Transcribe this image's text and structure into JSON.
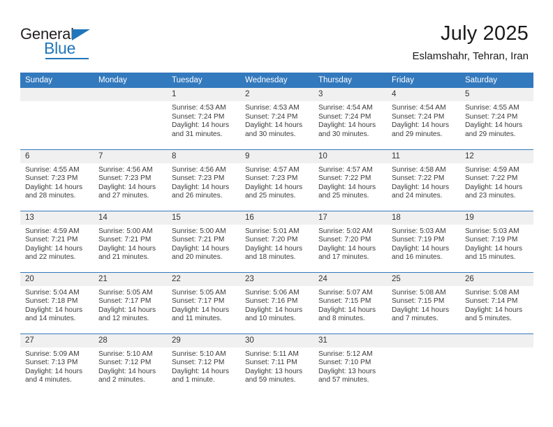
{
  "brand": {
    "name_top": "General",
    "name_bottom": "Blue",
    "accent_color": "#2175ba"
  },
  "header": {
    "title": "July 2025",
    "subtitle": "Eslamshahr, Tehran, Iran"
  },
  "theme": {
    "header_row_bg": "#3379bd",
    "daynum_bg": "#f0f0f0",
    "text_color": "#3a3a3a"
  },
  "weekday_headers": [
    "Sunday",
    "Monday",
    "Tuesday",
    "Wednesday",
    "Thursday",
    "Friday",
    "Saturday"
  ],
  "weeks": [
    [
      {
        "day": "",
        "blank": true
      },
      {
        "day": "",
        "blank": true
      },
      {
        "day": "1",
        "sunrise": "Sunrise: 4:53 AM",
        "sunset": "Sunset: 7:24 PM",
        "daylight1": "Daylight: 14 hours",
        "daylight2": "and 31 minutes."
      },
      {
        "day": "2",
        "sunrise": "Sunrise: 4:53 AM",
        "sunset": "Sunset: 7:24 PM",
        "daylight1": "Daylight: 14 hours",
        "daylight2": "and 30 minutes."
      },
      {
        "day": "3",
        "sunrise": "Sunrise: 4:54 AM",
        "sunset": "Sunset: 7:24 PM",
        "daylight1": "Daylight: 14 hours",
        "daylight2": "and 30 minutes."
      },
      {
        "day": "4",
        "sunrise": "Sunrise: 4:54 AM",
        "sunset": "Sunset: 7:24 PM",
        "daylight1": "Daylight: 14 hours",
        "daylight2": "and 29 minutes."
      },
      {
        "day": "5",
        "sunrise": "Sunrise: 4:55 AM",
        "sunset": "Sunset: 7:24 PM",
        "daylight1": "Daylight: 14 hours",
        "daylight2": "and 29 minutes."
      }
    ],
    [
      {
        "day": "6",
        "sunrise": "Sunrise: 4:55 AM",
        "sunset": "Sunset: 7:23 PM",
        "daylight1": "Daylight: 14 hours",
        "daylight2": "and 28 minutes."
      },
      {
        "day": "7",
        "sunrise": "Sunrise: 4:56 AM",
        "sunset": "Sunset: 7:23 PM",
        "daylight1": "Daylight: 14 hours",
        "daylight2": "and 27 minutes."
      },
      {
        "day": "8",
        "sunrise": "Sunrise: 4:56 AM",
        "sunset": "Sunset: 7:23 PM",
        "daylight1": "Daylight: 14 hours",
        "daylight2": "and 26 minutes."
      },
      {
        "day": "9",
        "sunrise": "Sunrise: 4:57 AM",
        "sunset": "Sunset: 7:23 PM",
        "daylight1": "Daylight: 14 hours",
        "daylight2": "and 25 minutes."
      },
      {
        "day": "10",
        "sunrise": "Sunrise: 4:57 AM",
        "sunset": "Sunset: 7:22 PM",
        "daylight1": "Daylight: 14 hours",
        "daylight2": "and 25 minutes."
      },
      {
        "day": "11",
        "sunrise": "Sunrise: 4:58 AM",
        "sunset": "Sunset: 7:22 PM",
        "daylight1": "Daylight: 14 hours",
        "daylight2": "and 24 minutes."
      },
      {
        "day": "12",
        "sunrise": "Sunrise: 4:59 AM",
        "sunset": "Sunset: 7:22 PM",
        "daylight1": "Daylight: 14 hours",
        "daylight2": "and 23 minutes."
      }
    ],
    [
      {
        "day": "13",
        "sunrise": "Sunrise: 4:59 AM",
        "sunset": "Sunset: 7:21 PM",
        "daylight1": "Daylight: 14 hours",
        "daylight2": "and 22 minutes."
      },
      {
        "day": "14",
        "sunrise": "Sunrise: 5:00 AM",
        "sunset": "Sunset: 7:21 PM",
        "daylight1": "Daylight: 14 hours",
        "daylight2": "and 21 minutes."
      },
      {
        "day": "15",
        "sunrise": "Sunrise: 5:00 AM",
        "sunset": "Sunset: 7:21 PM",
        "daylight1": "Daylight: 14 hours",
        "daylight2": "and 20 minutes."
      },
      {
        "day": "16",
        "sunrise": "Sunrise: 5:01 AM",
        "sunset": "Sunset: 7:20 PM",
        "daylight1": "Daylight: 14 hours",
        "daylight2": "and 18 minutes."
      },
      {
        "day": "17",
        "sunrise": "Sunrise: 5:02 AM",
        "sunset": "Sunset: 7:20 PM",
        "daylight1": "Daylight: 14 hours",
        "daylight2": "and 17 minutes."
      },
      {
        "day": "18",
        "sunrise": "Sunrise: 5:03 AM",
        "sunset": "Sunset: 7:19 PM",
        "daylight1": "Daylight: 14 hours",
        "daylight2": "and 16 minutes."
      },
      {
        "day": "19",
        "sunrise": "Sunrise: 5:03 AM",
        "sunset": "Sunset: 7:19 PM",
        "daylight1": "Daylight: 14 hours",
        "daylight2": "and 15 minutes."
      }
    ],
    [
      {
        "day": "20",
        "sunrise": "Sunrise: 5:04 AM",
        "sunset": "Sunset: 7:18 PM",
        "daylight1": "Daylight: 14 hours",
        "daylight2": "and 14 minutes."
      },
      {
        "day": "21",
        "sunrise": "Sunrise: 5:05 AM",
        "sunset": "Sunset: 7:17 PM",
        "daylight1": "Daylight: 14 hours",
        "daylight2": "and 12 minutes."
      },
      {
        "day": "22",
        "sunrise": "Sunrise: 5:05 AM",
        "sunset": "Sunset: 7:17 PM",
        "daylight1": "Daylight: 14 hours",
        "daylight2": "and 11 minutes."
      },
      {
        "day": "23",
        "sunrise": "Sunrise: 5:06 AM",
        "sunset": "Sunset: 7:16 PM",
        "daylight1": "Daylight: 14 hours",
        "daylight2": "and 10 minutes."
      },
      {
        "day": "24",
        "sunrise": "Sunrise: 5:07 AM",
        "sunset": "Sunset: 7:15 PM",
        "daylight1": "Daylight: 14 hours",
        "daylight2": "and 8 minutes."
      },
      {
        "day": "25",
        "sunrise": "Sunrise: 5:08 AM",
        "sunset": "Sunset: 7:15 PM",
        "daylight1": "Daylight: 14 hours",
        "daylight2": "and 7 minutes."
      },
      {
        "day": "26",
        "sunrise": "Sunrise: 5:08 AM",
        "sunset": "Sunset: 7:14 PM",
        "daylight1": "Daylight: 14 hours",
        "daylight2": "and 5 minutes."
      }
    ],
    [
      {
        "day": "27",
        "sunrise": "Sunrise: 5:09 AM",
        "sunset": "Sunset: 7:13 PM",
        "daylight1": "Daylight: 14 hours",
        "daylight2": "and 4 minutes."
      },
      {
        "day": "28",
        "sunrise": "Sunrise: 5:10 AM",
        "sunset": "Sunset: 7:12 PM",
        "daylight1": "Daylight: 14 hours",
        "daylight2": "and 2 minutes."
      },
      {
        "day": "29",
        "sunrise": "Sunrise: 5:10 AM",
        "sunset": "Sunset: 7:12 PM",
        "daylight1": "Daylight: 14 hours",
        "daylight2": "and 1 minute."
      },
      {
        "day": "30",
        "sunrise": "Sunrise: 5:11 AM",
        "sunset": "Sunset: 7:11 PM",
        "daylight1": "Daylight: 13 hours",
        "daylight2": "and 59 minutes."
      },
      {
        "day": "31",
        "sunrise": "Sunrise: 5:12 AM",
        "sunset": "Sunset: 7:10 PM",
        "daylight1": "Daylight: 13 hours",
        "daylight2": "and 57 minutes."
      },
      {
        "day": "",
        "blank": true
      },
      {
        "day": "",
        "blank": true
      }
    ]
  ]
}
